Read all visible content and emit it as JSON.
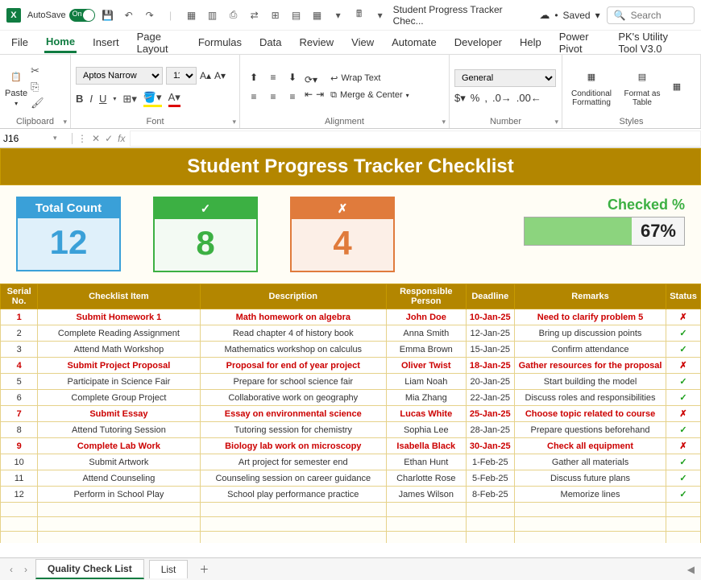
{
  "titlebar": {
    "autosave_label": "AutoSave",
    "autosave_on": "On",
    "doc_name": "Student Progress Tracker Chec...",
    "saved_status": "Saved",
    "search_placeholder": "Search"
  },
  "tabs": {
    "file": "File",
    "home": "Home",
    "insert": "Insert",
    "page_layout": "Page Layout",
    "formulas": "Formulas",
    "data": "Data",
    "review": "Review",
    "view": "View",
    "automate": "Automate",
    "developer": "Developer",
    "help": "Help",
    "power_pivot": "Power Pivot",
    "utility": "PK's Utility Tool V3.0"
  },
  "ribbon": {
    "clipboard_label": "Clipboard",
    "paste": "Paste",
    "font_label": "Font",
    "font_name": "Aptos Narrow",
    "font_size": "11",
    "alignment_label": "Alignment",
    "wrap_text": "Wrap Text",
    "merge_center": "Merge & Center",
    "number_label": "Number",
    "number_format": "General",
    "styles_label": "Styles",
    "cond_format": "Conditional Formatting",
    "format_table": "Format as Table",
    "cell_styles": "Cell Styles"
  },
  "formula_bar": {
    "cell_ref": "J16",
    "formula": ""
  },
  "sheet": {
    "title": "Student Progress Tracker Checklist",
    "cards": {
      "total_label": "Total Count",
      "total_value": "12",
      "check_symbol": "✓",
      "check_value": "8",
      "x_symbol": "✗",
      "x_value": "4"
    },
    "checked_label": "Checked %",
    "checked_pct": "67%",
    "progress_bar_width": "67%",
    "headers": {
      "serial": "Serial No.",
      "item": "Checklist Item",
      "desc": "Description",
      "resp": "Responsible Person",
      "dead": "Deadline",
      "rem": "Remarks",
      "stat": "Status"
    },
    "rows": [
      {
        "n": "1",
        "item": "Submit Homework 1",
        "desc": "Math homework on algebra",
        "resp": "John Doe",
        "dead": "10-Jan-25",
        "rem": "Need to clarify problem 5",
        "status": "✗",
        "x": true
      },
      {
        "n": "2",
        "item": "Complete Reading Assignment",
        "desc": "Read chapter 4 of history book",
        "resp": "Anna Smith",
        "dead": "12-Jan-25",
        "rem": "Bring up discussion points",
        "status": "✓",
        "x": false
      },
      {
        "n": "3",
        "item": "Attend Math Workshop",
        "desc": "Mathematics workshop on calculus",
        "resp": "Emma Brown",
        "dead": "15-Jan-25",
        "rem": "Confirm attendance",
        "status": "✓",
        "x": false
      },
      {
        "n": "4",
        "item": "Submit Project Proposal",
        "desc": "Proposal for end of year project",
        "resp": "Oliver Twist",
        "dead": "18-Jan-25",
        "rem": "Gather resources for the proposal",
        "status": "✗",
        "x": true
      },
      {
        "n": "5",
        "item": "Participate in Science Fair",
        "desc": "Prepare for school science fair",
        "resp": "Liam Noah",
        "dead": "20-Jan-25",
        "rem": "Start building the model",
        "status": "✓",
        "x": false
      },
      {
        "n": "6",
        "item": "Complete Group Project",
        "desc": "Collaborative work on geography",
        "resp": "Mia Zhang",
        "dead": "22-Jan-25",
        "rem": "Discuss roles and responsibilities",
        "status": "✓",
        "x": false
      },
      {
        "n": "7",
        "item": "Submit Essay",
        "desc": "Essay on environmental science",
        "resp": "Lucas White",
        "dead": "25-Jan-25",
        "rem": "Choose topic related to course",
        "status": "✗",
        "x": true
      },
      {
        "n": "8",
        "item": "Attend Tutoring Session",
        "desc": "Tutoring session for chemistry",
        "resp": "Sophia Lee",
        "dead": "28-Jan-25",
        "rem": "Prepare questions beforehand",
        "status": "✓",
        "x": false
      },
      {
        "n": "9",
        "item": "Complete Lab Work",
        "desc": "Biology lab work on microscopy",
        "resp": "Isabella Black",
        "dead": "30-Jan-25",
        "rem": "Check all equipment",
        "status": "✗",
        "x": true
      },
      {
        "n": "10",
        "item": "Submit Artwork",
        "desc": "Art project for semester end",
        "resp": "Ethan Hunt",
        "dead": "1-Feb-25",
        "rem": "Gather all materials",
        "status": "✓",
        "x": false
      },
      {
        "n": "11",
        "item": "Attend Counseling",
        "desc": "Counseling session on career guidance",
        "resp": "Charlotte Rose",
        "dead": "5-Feb-25",
        "rem": "Discuss future plans",
        "status": "✓",
        "x": false
      },
      {
        "n": "12",
        "item": "Perform in School Play",
        "desc": "School play performance practice",
        "resp": "James Wilson",
        "dead": "8-Feb-25",
        "rem": "Memorize lines",
        "status": "✓",
        "x": false
      }
    ]
  },
  "sheet_tabs": {
    "active": "Quality Check List",
    "other": "List"
  }
}
